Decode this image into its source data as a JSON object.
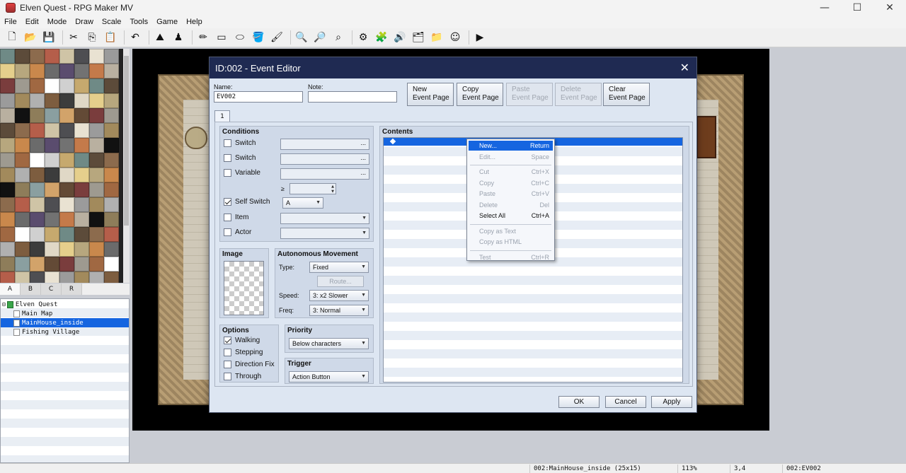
{
  "window": {
    "title": "Elven Quest - RPG Maker MV",
    "controls": [
      "—",
      "☐",
      "✕"
    ]
  },
  "menu": [
    "File",
    "Edit",
    "Mode",
    "Draw",
    "Scale",
    "Tools",
    "Game",
    "Help"
  ],
  "toolbar": {
    "icons": [
      {
        "name": "new-project-icon",
        "glyph": "🗋"
      },
      {
        "name": "open-project-icon",
        "glyph": "📂"
      },
      {
        "name": "save-project-icon",
        "glyph": "💾"
      },
      {
        "name": "cut-icon",
        "glyph": "✂"
      },
      {
        "name": "copy-icon",
        "glyph": "⎘"
      },
      {
        "name": "paste-icon",
        "glyph": "📋"
      },
      {
        "name": "undo-icon",
        "glyph": "↶"
      },
      {
        "name": "map-mode-icon",
        "glyph": "⛰"
      },
      {
        "name": "event-mode-icon",
        "glyph": "♟"
      },
      {
        "name": "pencil-icon",
        "glyph": "✏"
      },
      {
        "name": "rectangle-icon",
        "glyph": "▭"
      },
      {
        "name": "ellipse-icon",
        "glyph": "⬭"
      },
      {
        "name": "fill-icon",
        "glyph": "🪣"
      },
      {
        "name": "shadow-pen-icon",
        "glyph": "🖌"
      },
      {
        "name": "zoom-in-icon",
        "glyph": "🔍"
      },
      {
        "name": "zoom-out-icon",
        "glyph": "🔎"
      },
      {
        "name": "zoom-actual-icon",
        "glyph": "⌕"
      },
      {
        "name": "database-icon",
        "glyph": "⚙"
      },
      {
        "name": "plugin-manager-icon",
        "glyph": "🧩"
      },
      {
        "name": "sound-test-icon",
        "glyph": "🔊"
      },
      {
        "name": "event-searcher-icon",
        "glyph": "🗂"
      },
      {
        "name": "resource-manager-icon",
        "glyph": "📁"
      },
      {
        "name": "character-generator-icon",
        "glyph": "☺"
      },
      {
        "name": "playtest-icon",
        "glyph": "▶"
      }
    ]
  },
  "tile_tabs": [
    "A",
    "B",
    "C",
    "R"
  ],
  "map_tree": [
    {
      "label": "Elven Quest",
      "level": 0,
      "selected": false
    },
    {
      "label": "Main Map",
      "level": 1,
      "selected": false
    },
    {
      "label": "MainHouse_inside",
      "level": 1,
      "selected": true
    },
    {
      "label": "Fishing Village",
      "level": 1,
      "selected": false
    }
  ],
  "status": {
    "map": "002:MainHouse_inside (25x15)",
    "zoom": "113%",
    "coords": "3,4",
    "event": "002:EV002"
  },
  "dialog": {
    "title": "ID:002 - Event Editor",
    "close": "✕",
    "name_label": "Name:",
    "name_value": "EV002",
    "note_label": "Note:",
    "note_value": "",
    "page_buttons": [
      {
        "line1": "New",
        "line2": "Event Page",
        "enabled": true
      },
      {
        "line1": "Copy",
        "line2": "Event Page",
        "enabled": true
      },
      {
        "line1": "Paste",
        "line2": "Event Page",
        "enabled": false
      },
      {
        "line1": "Delete",
        "line2": "Event Page",
        "enabled": false
      },
      {
        "line1": "Clear",
        "line2": "Event Page",
        "enabled": true
      }
    ],
    "page_tab": "1",
    "conditions": {
      "title": "Conditions",
      "switch1": {
        "label": "Switch",
        "checked": false,
        "value": "..."
      },
      "switch2": {
        "label": "Switch",
        "checked": false,
        "value": "..."
      },
      "variable": {
        "label": "Variable",
        "checked": false,
        "value": "..."
      },
      "ge": "≥",
      "self_switch": {
        "label": "Self Switch",
        "checked": true,
        "value": "A"
      },
      "item": {
        "label": "Item",
        "checked": false
      },
      "actor": {
        "label": "Actor",
        "checked": false
      }
    },
    "image": {
      "title": "Image"
    },
    "movement": {
      "title": "Autonomous Movement",
      "type_label": "Type:",
      "type_value": "Fixed",
      "route_label": "Route...",
      "speed_label": "Speed:",
      "speed_value": "3: x2 Slower",
      "freq_label": "Freq:",
      "freq_value": "3: Normal"
    },
    "options": {
      "title": "Options",
      "walking": {
        "label": "Walking",
        "checked": true
      },
      "stepping": {
        "label": "Stepping",
        "checked": false
      },
      "direction_fix": {
        "label": "Direction Fix",
        "checked": false
      },
      "through": {
        "label": "Through",
        "checked": false
      }
    },
    "priority": {
      "title": "Priority",
      "value": "Below characters"
    },
    "trigger": {
      "title": "Trigger",
      "value": "Action Button"
    },
    "contents": {
      "title": "Contents"
    },
    "footer": {
      "ok": "OK",
      "cancel": "Cancel",
      "apply": "Apply"
    }
  },
  "context_menu": [
    {
      "label": "New...",
      "shortcut": "Return",
      "enabled": true,
      "highlighted": true
    },
    {
      "label": "Edit...",
      "shortcut": "Space",
      "enabled": false
    },
    {
      "sep": true
    },
    {
      "label": "Cut",
      "shortcut": "Ctrl+X",
      "enabled": false
    },
    {
      "label": "Copy",
      "shortcut": "Ctrl+C",
      "enabled": false
    },
    {
      "label": "Paste",
      "shortcut": "Ctrl+V",
      "enabled": false
    },
    {
      "label": "Delete",
      "shortcut": "Del",
      "enabled": false
    },
    {
      "label": "Select All",
      "shortcut": "Ctrl+A",
      "enabled": true
    },
    {
      "sep": true
    },
    {
      "label": "Copy as Text",
      "shortcut": "",
      "enabled": false
    },
    {
      "label": "Copy as HTML",
      "shortcut": "",
      "enabled": false
    },
    {
      "sep": true
    },
    {
      "label": "Test",
      "shortcut": "Ctrl+R",
      "enabled": false
    }
  ],
  "tile_colors": [
    "#6f8a86",
    "#8a9fa0",
    "#b7a77e",
    "#4e4e52",
    "#a06842",
    "#c47a4a",
    "#7d5d3f",
    "#5c4b3a",
    "#d2a36a",
    "#c9884c",
    "#e9e2d2",
    "#ffffff",
    "#b9b0a0",
    "#3c3c3c",
    "#8c6b4d",
    "#634a36",
    "#6b6b6b",
    "#9b9b9b",
    "#d0d0d0",
    "#111111",
    "#e0d8c6",
    "#b55e4a",
    "#7a3d3d",
    "#5a4c6e",
    "#a28a5c",
    "#c6a96e",
    "#8e7d5a",
    "#e5cf8c",
    "#cfc4a6",
    "#9e9a90",
    "#727272",
    "#b0b0b0"
  ]
}
